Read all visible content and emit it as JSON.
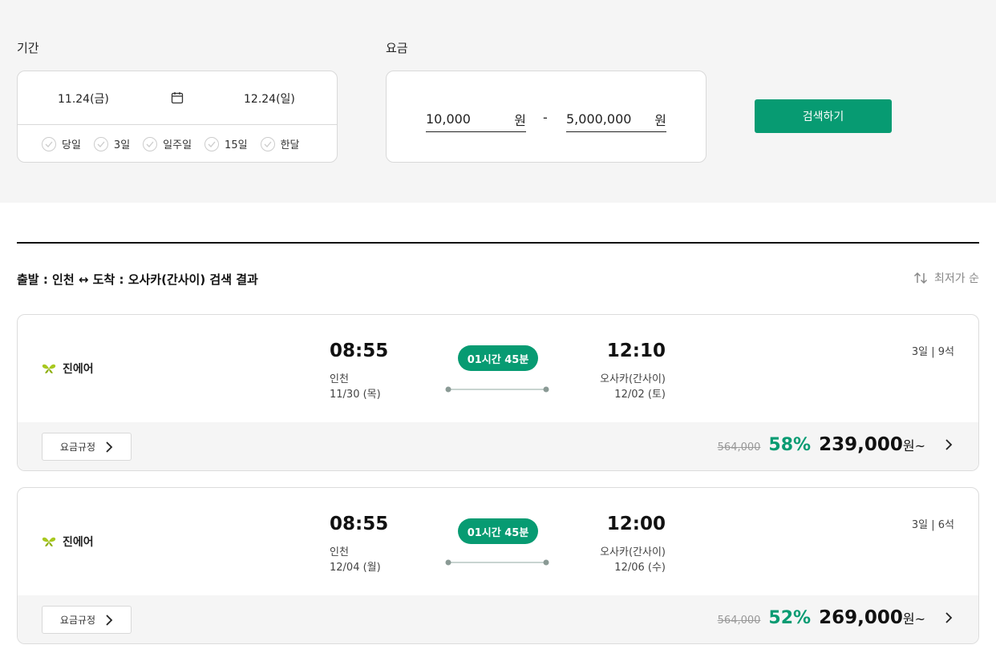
{
  "filter": {
    "period_label": "기간",
    "fare_label": "요금",
    "start_date": "11.24(금)",
    "end_date": "12.24(일)",
    "quick_options": [
      "당일",
      "3일",
      "일주일",
      "15일",
      "한달"
    ],
    "fare_min": "10,000",
    "fare_max": "5,000,000",
    "currency": "원",
    "dash": "-",
    "search_label": "검색하기"
  },
  "results": {
    "title": "출발 : 인천 ↔ 도착 : 오사카(간사이) 검색 결과",
    "sort_label": "최저가 순",
    "colors": {
      "accent": "#079b72",
      "airline_logo": "#a8c81f"
    },
    "flights": [
      {
        "airline": "진에어",
        "dep_time": "08:55",
        "dep_city": "인천",
        "dep_date": "11/30 (목)",
        "duration": "01시간 45분",
        "arr_time": "12:10",
        "arr_city": "오사카(간사이)",
        "arr_date": "12/02 (토)",
        "seats": "3일 | 9석",
        "rule_label": "요금규정",
        "orig_price": "564,000",
        "discount": "58%",
        "price": "239,000",
        "unit": "원~"
      },
      {
        "airline": "진에어",
        "dep_time": "08:55",
        "dep_city": "인천",
        "dep_date": "12/04 (월)",
        "duration": "01시간 45분",
        "arr_time": "12:00",
        "arr_city": "오사카(간사이)",
        "arr_date": "12/06 (수)",
        "seats": "3일 | 6석",
        "rule_label": "요금규정",
        "orig_price": "564,000",
        "discount": "52%",
        "price": "269,000",
        "unit": "원~"
      }
    ]
  }
}
